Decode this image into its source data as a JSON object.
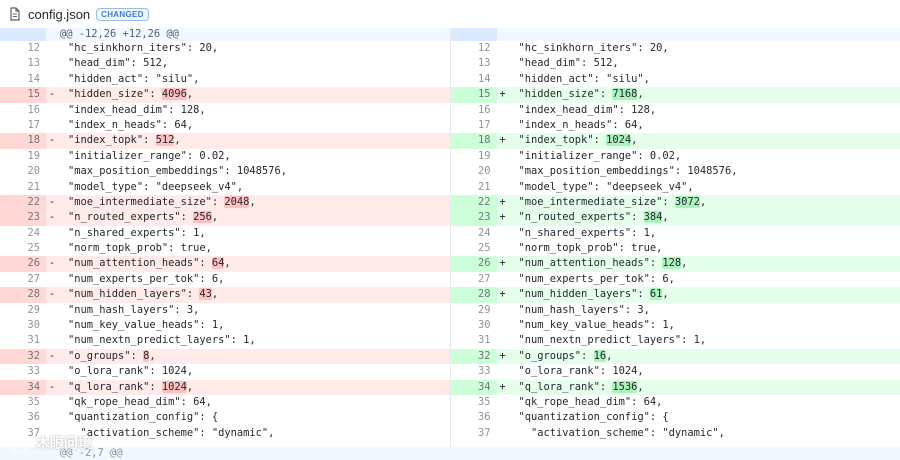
{
  "file": {
    "name": "config.json",
    "badge": "CHANGED"
  },
  "hunk": {
    "header": "@@ -12,26 +12,26 @@",
    "footer": "@@ -2,7 @@"
  },
  "watermark": "木眼问境",
  "left": [
    {
      "n": "12",
      "t": "ctx",
      "c": "\"hc_sinkhorn_iters\": 20,"
    },
    {
      "n": "13",
      "t": "ctx",
      "c": "\"head_dim\": 512,"
    },
    {
      "n": "14",
      "t": "ctx",
      "c": "\"hidden_act\": \"silu\","
    },
    {
      "n": "15",
      "t": "del",
      "p": "\"hidden_size\": ",
      "h": "4096",
      "s": ","
    },
    {
      "n": "16",
      "t": "ctx",
      "c": "\"index_head_dim\": 128,"
    },
    {
      "n": "17",
      "t": "ctx",
      "c": "\"index_n_heads\": 64,"
    },
    {
      "n": "18",
      "t": "del",
      "p": "\"index_topk\": ",
      "h": "512",
      "s": ","
    },
    {
      "n": "19",
      "t": "ctx",
      "c": "\"initializer_range\": 0.02,"
    },
    {
      "n": "20",
      "t": "ctx",
      "c": "\"max_position_embeddings\": 1048576,"
    },
    {
      "n": "21",
      "t": "ctx",
      "c": "\"model_type\": \"deepseek_v4\","
    },
    {
      "n": "22",
      "t": "del",
      "p": "\"moe_intermediate_size\": ",
      "h": "2048",
      "s": ","
    },
    {
      "n": "23",
      "t": "del",
      "p": "\"n_routed_experts\": ",
      "h": "256",
      "s": ","
    },
    {
      "n": "24",
      "t": "ctx",
      "c": "\"n_shared_experts\": 1,"
    },
    {
      "n": "25",
      "t": "ctx",
      "c": "\"norm_topk_prob\": true,"
    },
    {
      "n": "26",
      "t": "del",
      "p": "\"num_attention_heads\": ",
      "h": "64",
      "s": ","
    },
    {
      "n": "27",
      "t": "ctx",
      "c": "\"num_experts_per_tok\": 6,"
    },
    {
      "n": "28",
      "t": "del",
      "p": "\"num_hidden_layers\": ",
      "h": "43",
      "s": ","
    },
    {
      "n": "29",
      "t": "ctx",
      "c": "\"num_hash_layers\": 3,"
    },
    {
      "n": "30",
      "t": "ctx",
      "c": "\"num_key_value_heads\": 1,"
    },
    {
      "n": "31",
      "t": "ctx",
      "c": "\"num_nextn_predict_layers\": 1,"
    },
    {
      "n": "32",
      "t": "del",
      "p": "\"o_groups\": ",
      "h": "8",
      "s": ","
    },
    {
      "n": "33",
      "t": "ctx",
      "c": "\"o_lora_rank\": 1024,"
    },
    {
      "n": "34",
      "t": "del",
      "p": "\"q_lora_rank\": ",
      "h": "1024",
      "s": ","
    },
    {
      "n": "35",
      "t": "ctx",
      "c": "\"qk_rope_head_dim\": 64,"
    },
    {
      "n": "36",
      "t": "ctx",
      "c": "\"quantization_config\": {"
    },
    {
      "n": "37",
      "t": "ctx",
      "c": "  \"activation_scheme\": \"dynamic\","
    }
  ],
  "right": [
    {
      "n": "12",
      "t": "ctx",
      "c": "\"hc_sinkhorn_iters\": 20,"
    },
    {
      "n": "13",
      "t": "ctx",
      "c": "\"head_dim\": 512,"
    },
    {
      "n": "14",
      "t": "ctx",
      "c": "\"hidden_act\": \"silu\","
    },
    {
      "n": "15",
      "t": "add",
      "p": "\"hidden_size\": ",
      "h": "7168",
      "s": ","
    },
    {
      "n": "16",
      "t": "ctx",
      "c": "\"index_head_dim\": 128,"
    },
    {
      "n": "17",
      "t": "ctx",
      "c": "\"index_n_heads\": 64,"
    },
    {
      "n": "18",
      "t": "add",
      "p": "\"index_topk\": ",
      "h": "1024",
      "s": ","
    },
    {
      "n": "19",
      "t": "ctx",
      "c": "\"initializer_range\": 0.02,"
    },
    {
      "n": "20",
      "t": "ctx",
      "c": "\"max_position_embeddings\": 1048576,"
    },
    {
      "n": "21",
      "t": "ctx",
      "c": "\"model_type\": \"deepseek_v4\","
    },
    {
      "n": "22",
      "t": "add",
      "p": "\"moe_intermediate_size\": ",
      "h": "3072",
      "s": ","
    },
    {
      "n": "23",
      "t": "add",
      "p": "\"n_routed_experts\": ",
      "h": "384",
      "s": ","
    },
    {
      "n": "24",
      "t": "ctx",
      "c": "\"n_shared_experts\": 1,"
    },
    {
      "n": "25",
      "t": "ctx",
      "c": "\"norm_topk_prob\": true,"
    },
    {
      "n": "26",
      "t": "add",
      "p": "\"num_attention_heads\": ",
      "h": "128",
      "s": ","
    },
    {
      "n": "27",
      "t": "ctx",
      "c": "\"num_experts_per_tok\": 6,"
    },
    {
      "n": "28",
      "t": "add",
      "p": "\"num_hidden_layers\": ",
      "h": "61",
      "s": ","
    },
    {
      "n": "29",
      "t": "ctx",
      "c": "\"num_hash_layers\": 3,"
    },
    {
      "n": "30",
      "t": "ctx",
      "c": "\"num_key_value_heads\": 1,"
    },
    {
      "n": "31",
      "t": "ctx",
      "c": "\"num_nextn_predict_layers\": 1,"
    },
    {
      "n": "32",
      "t": "add",
      "p": "\"o_groups\": ",
      "h": "16",
      "s": ","
    },
    {
      "n": "33",
      "t": "ctx",
      "c": "\"o_lora_rank\": 1024,"
    },
    {
      "n": "34",
      "t": "add",
      "p": "\"q_lora_rank\": ",
      "h": "1536",
      "s": ","
    },
    {
      "n": "35",
      "t": "ctx",
      "c": "\"qk_rope_head_dim\": 64,"
    },
    {
      "n": "36",
      "t": "ctx",
      "c": "\"quantization_config\": {"
    },
    {
      "n": "37",
      "t": "ctx",
      "c": "  \"activation_scheme\": \"dynamic\","
    }
  ]
}
